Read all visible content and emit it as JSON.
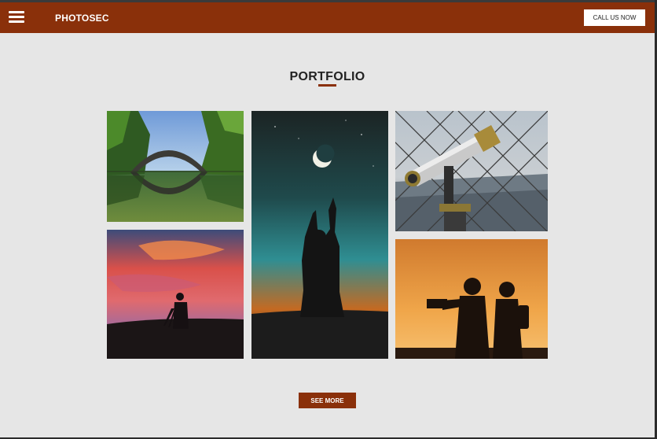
{
  "header": {
    "brand": "PHOTOSEC",
    "cta_label": "CALL US NOW"
  },
  "portfolio": {
    "title": "PORTFOLIO",
    "see_more_label": "SEE MORE",
    "images": [
      {
        "subject": "stone arch bridge reflected in lake"
      },
      {
        "subject": "silhouette reaching toward crescent moon"
      },
      {
        "subject": "coin-operated telescope behind wire fence above city"
      },
      {
        "subject": "photographer silhouette with tripod at pink sunset"
      },
      {
        "subject": "two photographers silhouetted against orange sky"
      }
    ]
  },
  "colors": {
    "accent": "#8a300a",
    "background": "#e6e6e6"
  }
}
